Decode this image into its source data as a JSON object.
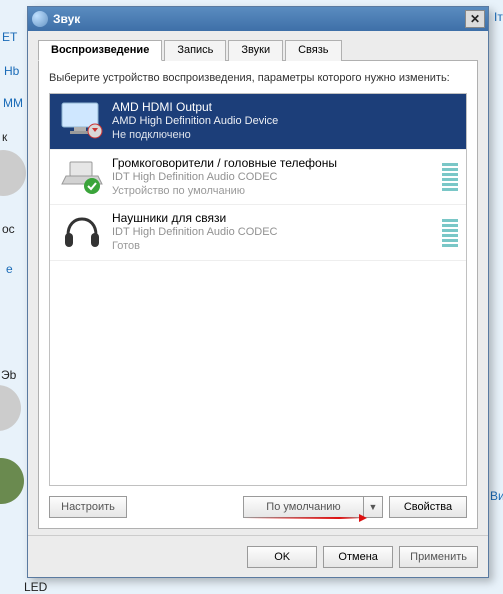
{
  "window": {
    "title": "Звук"
  },
  "tabs": {
    "playback": "Воспроизведение",
    "recording": "Запись",
    "sounds": "Звуки",
    "comm": "Связь"
  },
  "instructions": "Выберите устройство воспроизведения, параметры которого нужно изменить:",
  "devices": [
    {
      "name": "AMD HDMI Output",
      "desc": "AMD High Definition Audio Device",
      "status": "Не подключено"
    },
    {
      "name": "Громкоговорители / головные телефоны",
      "desc": "IDT High Definition Audio CODEC",
      "status": "Устройство по умолчанию"
    },
    {
      "name": "Наушники для связи",
      "desc": "IDT High Definition Audio CODEC",
      "status": "Готов"
    }
  ],
  "buttons": {
    "configure": "Настроить",
    "set_default": "По умолчанию",
    "properties": "Свойства",
    "ok": "OK",
    "cancel": "Отмена",
    "apply": "Применить"
  },
  "backdrop": {
    "t1": "ЕТ",
    "t2": "Hb",
    "t3": "MM",
    "t4": "к",
    "t5": "oc",
    "t6": "e",
    "t7": "Эb",
    "t8": "LED",
    "t9": "Bи",
    "t10": "Iт"
  }
}
